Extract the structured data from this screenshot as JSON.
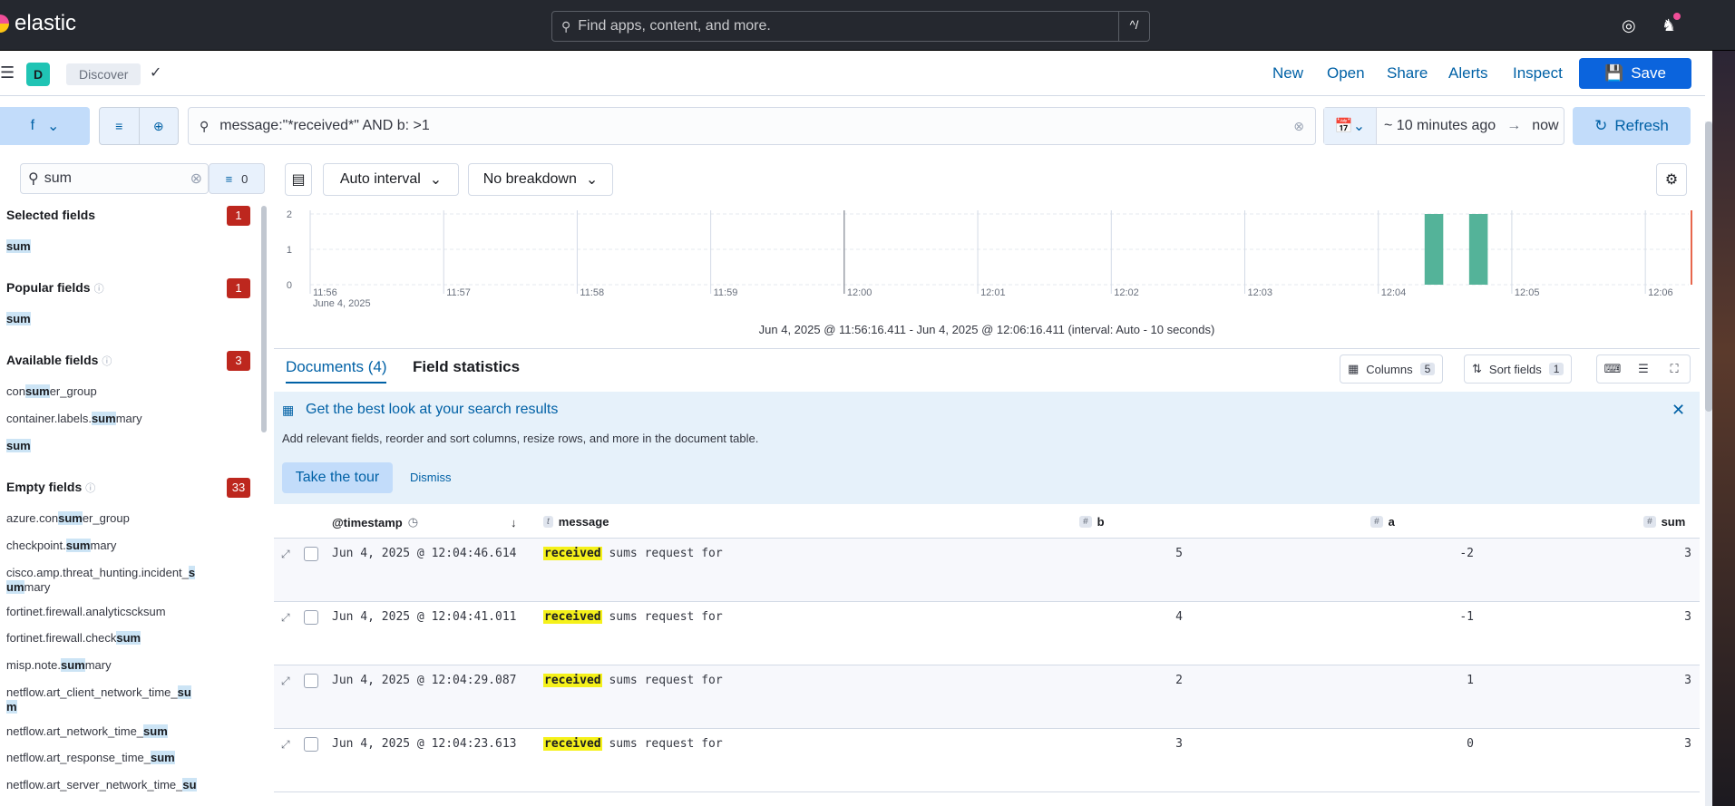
{
  "app": {
    "name": "elastic",
    "search_placeholder": "Find apps, content, and more.",
    "shortcut": "^/"
  },
  "header": {
    "space_initial": "D",
    "breadcrumb": "Discover",
    "links": [
      "New",
      "Open",
      "Share",
      "Alerts",
      "Inspect"
    ],
    "save_label": "Save"
  },
  "query": {
    "dataview_label": "f",
    "text": "message:\"*received*\" AND b: >1",
    "time_start": "~ 10 minutes ago",
    "time_end": "now",
    "refresh_label": "Refresh"
  },
  "sidebar": {
    "search_value": "sum",
    "filter_count": "0",
    "selected": {
      "title": "Selected fields",
      "count": "1",
      "items": [
        {
          "pre": "",
          "hl": "sum",
          "post": ""
        }
      ]
    },
    "popular": {
      "title": "Popular fields",
      "count": "1",
      "items": [
        {
          "pre": "",
          "hl": "sum",
          "post": ""
        }
      ]
    },
    "available": {
      "title": "Available fields",
      "count": "3",
      "items": [
        {
          "pre": "con",
          "hl": "sum",
          "post": "er_group"
        },
        {
          "pre": "container.labels.",
          "hl": "sum",
          "post": "mary"
        },
        {
          "pre": "",
          "hl": "sum",
          "post": ""
        }
      ]
    },
    "empty": {
      "title": "Empty fields",
      "count": "33",
      "items": [
        {
          "pre": "azure.con",
          "hl": "sum",
          "post": "er_group"
        },
        {
          "pre": "checkpoint.",
          "hl": "sum",
          "post": "mary"
        },
        {
          "pre": "cisco.amp.threat_hunting.incident_",
          "hl": "s",
          "post": "",
          "line2_hl": "um",
          "line2_post": "mary"
        },
        {
          "pre": "fortinet.firewall.analyticscksum",
          "hl": "",
          "post": ""
        },
        {
          "pre": "fortinet.firewall.check",
          "hl": "sum",
          "post": ""
        },
        {
          "pre": "misp.note.",
          "hl": "sum",
          "post": "mary"
        },
        {
          "pre": "netflow.art_client_network_time_",
          "hl": "su",
          "post": "",
          "line2_hl": "m",
          "line2_post": ""
        },
        {
          "pre": "netflow.art_network_time_",
          "hl": "sum",
          "post": ""
        },
        {
          "pre": "netflow.art_response_time_",
          "hl": "sum",
          "post": ""
        },
        {
          "pre": "netflow.art_server_network_time_",
          "hl": "su",
          "post": ""
        }
      ]
    }
  },
  "chart_controls": {
    "interval": "Auto interval",
    "breakdown": "No breakdown"
  },
  "chart_data": {
    "type": "bar",
    "y_ticks": [
      "0",
      "1",
      "2"
    ],
    "ylim": [
      0,
      2
    ],
    "x_ticks": [
      "11:56",
      "11:57",
      "11:58",
      "11:59",
      "12:00",
      "12:01",
      "12:02",
      "12:03",
      "12:04",
      "12:05",
      "12:06"
    ],
    "x_sublabel": "June 4, 2025",
    "bars": [
      {
        "x": "12:04:20",
        "value": 2
      },
      {
        "x": "12:04:40",
        "value": 2
      }
    ],
    "bar_color": "#54b399",
    "time_range": "Jun 4, 2025 @ 11:56:16.411 - Jun 4, 2025 @ 12:06:16.411 (interval: Auto - 10 seconds)"
  },
  "tabs": {
    "documents": "Documents (4)",
    "field_statistics": "Field statistics"
  },
  "toolbar": {
    "columns_label": "Columns",
    "columns_count": "5",
    "sort_label": "Sort fields",
    "sort_count": "1"
  },
  "callout": {
    "title": "Get the best look at your search results",
    "description": "Add relevant fields, reorder and sort columns, resize rows, and more in the document table.",
    "tour_label": "Take the tour",
    "dismiss_label": "Dismiss"
  },
  "table": {
    "headers": {
      "timestamp": "@timestamp",
      "message": "message",
      "b": "b",
      "a": "a",
      "sum": "sum"
    },
    "type_badges": {
      "message": "t",
      "number": "#"
    },
    "rows": [
      {
        "timestamp": "Jun 4, 2025 @ 12:04:46.614",
        "hl": "received",
        "rest": " sums request for",
        "b": "5",
        "a": "-2",
        "sum": "3"
      },
      {
        "timestamp": "Jun 4, 2025 @ 12:04:41.011",
        "hl": "received",
        "rest": " sums request for",
        "b": "4",
        "a": "-1",
        "sum": "3"
      },
      {
        "timestamp": "Jun 4, 2025 @ 12:04:29.087",
        "hl": "received",
        "rest": " sums request for",
        "b": "2",
        "a": "1",
        "sum": "3"
      },
      {
        "timestamp": "Jun 4, 2025 @ 12:04:23.613",
        "hl": "received",
        "rest": " sums request for",
        "b": "3",
        "a": "0",
        "sum": "3"
      }
    ]
  }
}
